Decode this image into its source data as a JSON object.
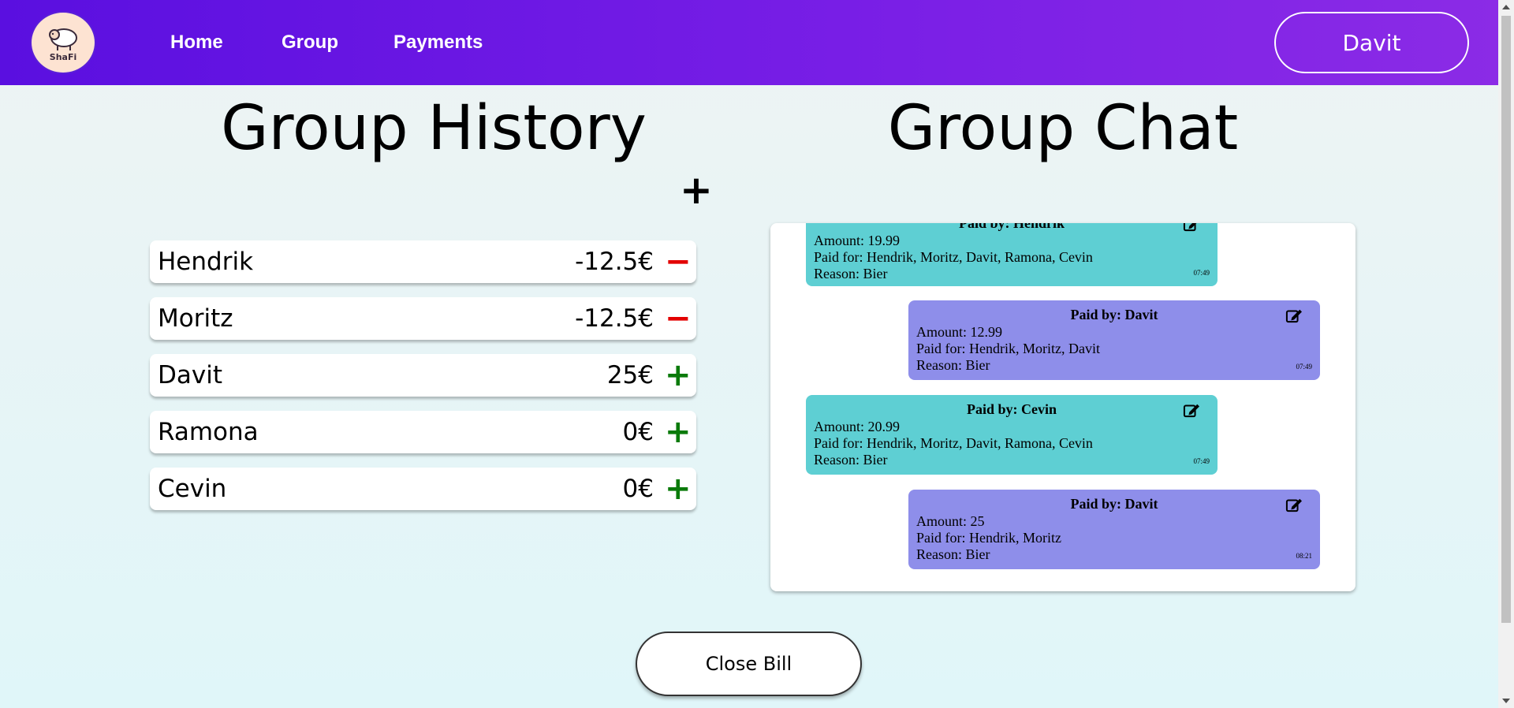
{
  "app": {
    "logo_text": "ShaFi"
  },
  "nav": {
    "home": "Home",
    "group": "Group",
    "payments": "Payments",
    "user": "Davit"
  },
  "history": {
    "title": "Group History",
    "add_symbol": "+",
    "members": [
      {
        "name": "Hendrik",
        "amount": "-12.5€",
        "sign": "−"
      },
      {
        "name": "Moritz",
        "amount": "-12.5€",
        "sign": "−"
      },
      {
        "name": "Davit",
        "amount": "25€",
        "sign": "+"
      },
      {
        "name": "Ramona",
        "amount": "0€",
        "sign": "+"
      },
      {
        "name": "Cevin",
        "amount": "0€",
        "sign": "+"
      }
    ]
  },
  "chat": {
    "title": "Group Chat",
    "messages": [
      {
        "header": "Paid by: Hendrik",
        "amount": "Amount: 19.99",
        "paid_for": "Paid for: Hendrik, Moritz, Davit, Ramona, Cevin",
        "reason": "Reason: Bier",
        "time": "07:49"
      },
      {
        "header": "Paid by: Davit",
        "amount": "Amount: 12.99",
        "paid_for": "Paid for: Hendrik, Moritz, Davit",
        "reason": "Reason: Bier",
        "time": "07:49"
      },
      {
        "header": "Paid by: Cevin",
        "amount": "Amount: 20.99",
        "paid_for": "Paid for: Hendrik, Moritz, Davit, Ramona, Cevin",
        "reason": "Reason: Bier",
        "time": "07:49"
      },
      {
        "header": "Paid by: Davit",
        "amount": "Amount: 25",
        "paid_for": "Paid for: Hendrik, Moritz",
        "reason": "Reason: Bier",
        "time": "08:21"
      }
    ]
  },
  "actions": {
    "close_bill": "Close Bill"
  },
  "colors": {
    "nav_gradient_start": "#5a0fe0",
    "nav_gradient_end": "#8b2be6",
    "message_teal": "#5ecfd3",
    "message_purple": "#8e8eea",
    "negative": "#e30000",
    "positive": "#0a7a0a"
  }
}
